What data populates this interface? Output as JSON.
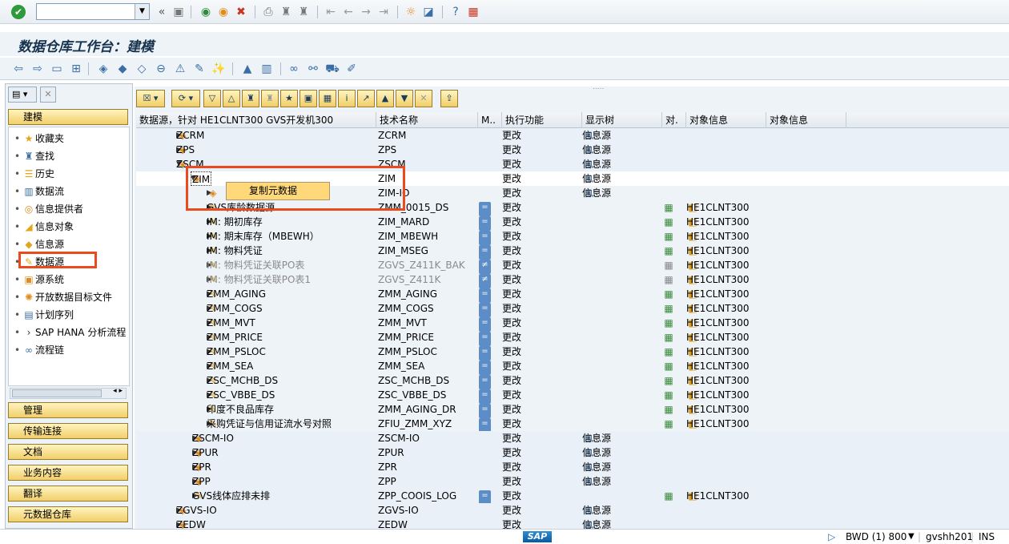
{
  "toolbar": {
    "command_placeholder": "",
    "icons": [
      "check-icon",
      "dropdown",
      "back-nav-icon",
      "save-icon",
      "back-icon",
      "exit-icon",
      "cancel-icon",
      "print-icon",
      "find-icon",
      "find-next-icon",
      "first-page-icon",
      "prev-page-icon",
      "next-page-icon",
      "last-page-icon",
      "new-session-icon",
      "shortcut-icon",
      "help-icon",
      "layout-icon"
    ]
  },
  "title": "数据仓库工作台：建模",
  "left": {
    "top_button": "建模",
    "items": [
      {
        "label": "收藏夹",
        "icon": "star-icon"
      },
      {
        "label": "查找",
        "icon": "binoculars-icon"
      },
      {
        "label": "历史",
        "icon": "history-icon"
      },
      {
        "label": "数据流",
        "icon": "dataflow-icon"
      },
      {
        "label": "信息提供者",
        "icon": "infoprovider-icon"
      },
      {
        "label": "信息对象",
        "icon": "infoobject-icon"
      },
      {
        "label": "信息源",
        "icon": "infosource-icon"
      },
      {
        "label": "数据源",
        "icon": "datasource-icon"
      },
      {
        "label": "源系统",
        "icon": "sourcesystem-icon"
      },
      {
        "label": "开放数据目标文件",
        "icon": "opendest-icon"
      },
      {
        "label": "计划序列",
        "icon": "process-chain-icon"
      },
      {
        "label": "SAP HANA 分析流程",
        "icon": "hana-icon"
      },
      {
        "label": "流程链",
        "icon": "chain-icon"
      }
    ],
    "buttons": [
      "管理",
      "传输连接",
      "文档",
      "业务内容",
      "翻译",
      "元数据仓库"
    ]
  },
  "columns": [
    "数据源，针对 HE1CLNT300 GVS开发机300",
    "技术名称",
    "M..",
    "执行功能",
    "显示树",
    "对.",
    "对象信息",
    "对象信息"
  ],
  "rows": [
    {
      "name": "ZCRM",
      "tech": "ZCRM",
      "func": "更改",
      "tree": "信息源",
      "obj": "",
      "kind": "folder"
    },
    {
      "name": "ZPS",
      "tech": "ZPS",
      "func": "更改",
      "tree": "信息源",
      "obj": "",
      "kind": "folder"
    },
    {
      "name": "ZSCM",
      "tech": "ZSCM",
      "func": "更改",
      "tree": "信息源",
      "obj": "",
      "kind": "folder"
    },
    {
      "name": "ZIM",
      "tech": "ZIM",
      "func": "更改",
      "tree": "信息源",
      "obj": "",
      "kind": "folder"
    },
    {
      "name": "",
      "tech": "ZIM-IO",
      "func": "更改",
      "tree": "信息源",
      "obj": "",
      "kind": "folder"
    },
    {
      "name": "GVS库龄数据源",
      "tech": "ZMM_0015_DS",
      "func": "更改",
      "tree": "",
      "obj": "HE1CLNT300",
      "kind": "ds"
    },
    {
      "name": "IM: 期初库存",
      "tech": "ZIM_MARD",
      "func": "更改",
      "tree": "",
      "obj": "HE1CLNT300",
      "kind": "ds"
    },
    {
      "name": "IM: 期末库存（MBEWH）",
      "tech": "ZIM_MBEWH",
      "func": "更改",
      "tree": "",
      "obj": "HE1CLNT300",
      "kind": "ds"
    },
    {
      "name": "IM: 物料凭证",
      "tech": "ZIM_MSEG",
      "func": "更改",
      "tree": "",
      "obj": "HE1CLNT300",
      "kind": "ds"
    },
    {
      "name": "IM: 物料凭证关联PO表",
      "tech": "ZGVS_Z411K_BAK",
      "func": "更改",
      "tree": "",
      "obj": "HE1CLNT300",
      "kind": "grey"
    },
    {
      "name": "IM: 物料凭证关联PO表1",
      "tech": "ZGVS_Z411K",
      "func": "更改",
      "tree": "",
      "obj": "HE1CLNT300",
      "kind": "grey"
    },
    {
      "name": "ZMM_AGING",
      "tech": "ZMM_AGING",
      "func": "更改",
      "tree": "",
      "obj": "HE1CLNT300",
      "kind": "ds"
    },
    {
      "name": "ZMM_COGS",
      "tech": "ZMM_COGS",
      "func": "更改",
      "tree": "",
      "obj": "HE1CLNT300",
      "kind": "ds"
    },
    {
      "name": "ZMM_MVT",
      "tech": "ZMM_MVT",
      "func": "更改",
      "tree": "",
      "obj": "HE1CLNT300",
      "kind": "ds"
    },
    {
      "name": "ZMM_PRICE",
      "tech": "ZMM_PRICE",
      "func": "更改",
      "tree": "",
      "obj": "HE1CLNT300",
      "kind": "ds"
    },
    {
      "name": "ZMM_PSLOC",
      "tech": "ZMM_PSLOC",
      "func": "更改",
      "tree": "",
      "obj": "HE1CLNT300",
      "kind": "ds"
    },
    {
      "name": "ZMM_SEA",
      "tech": "ZMM_SEA",
      "func": "更改",
      "tree": "",
      "obj": "HE1CLNT300",
      "kind": "ds"
    },
    {
      "name": "ZSC_MCHB_DS",
      "tech": "ZSC_MCHB_DS",
      "func": "更改",
      "tree": "",
      "obj": "HE1CLNT300",
      "kind": "ds"
    },
    {
      "name": "ZSC_VBBE_DS",
      "tech": "ZSC_VBBE_DS",
      "func": "更改",
      "tree": "",
      "obj": "HE1CLNT300",
      "kind": "ds"
    },
    {
      "name": "印度不良品库存",
      "tech": "ZMM_AGING_DR",
      "func": "更改",
      "tree": "",
      "obj": "HE1CLNT300",
      "kind": "ds"
    },
    {
      "name": "采购凭证与信用证流水号对照",
      "tech": "ZFIU_ZMM_XYZ",
      "func": "更改",
      "tree": "",
      "obj": "HE1CLNT300",
      "kind": "ds"
    },
    {
      "name": "ZSCM-IO",
      "tech": "ZSCM-IO",
      "func": "更改",
      "tree": "信息源",
      "obj": "",
      "kind": "folder"
    },
    {
      "name": "ZPUR",
      "tech": "ZPUR",
      "func": "更改",
      "tree": "信息源",
      "obj": "",
      "kind": "folder"
    },
    {
      "name": "ZPR",
      "tech": "ZPR",
      "func": "更改",
      "tree": "信息源",
      "obj": "",
      "kind": "folder"
    },
    {
      "name": "ZPP",
      "tech": "ZPP",
      "func": "更改",
      "tree": "信息源",
      "obj": "",
      "kind": "folder"
    },
    {
      "name": "GVS线体应排未排",
      "tech": "ZPP_COOIS_LOG",
      "func": "更改",
      "tree": "",
      "obj": "HE1CLNT300",
      "kind": "ds"
    },
    {
      "name": "ZGVS-IO",
      "tech": "ZGVS-IO",
      "func": "更改",
      "tree": "信息源",
      "obj": "",
      "kind": "folder"
    },
    {
      "name": "ZEDW",
      "tech": "ZEDW",
      "func": "更改",
      "tree": "信息源",
      "obj": "",
      "kind": "folder"
    }
  ],
  "context_menu": {
    "item": "复制元数据"
  },
  "status": {
    "system": "BWD (1) 800",
    "user": "gvshh201",
    "mode": "INS",
    "logo": "SAP"
  }
}
